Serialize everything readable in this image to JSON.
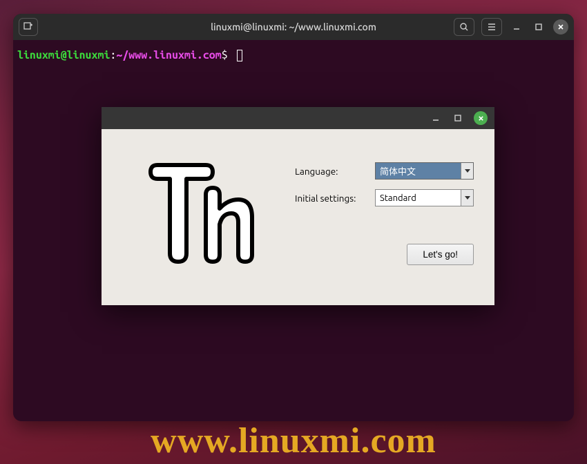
{
  "terminal": {
    "title": "linuxmi@linuxmi: ~/www.linuxmi.com",
    "prompt_user": "linuxmi@linuxmi",
    "prompt_sep": ":",
    "prompt_path": "~/www.linuxmi.com",
    "prompt_dollar": "$"
  },
  "dialog": {
    "language_label": "Language:",
    "language_value": "简体中文",
    "initial_settings_label": "Initial settings:",
    "initial_settings_value": "Standard",
    "go_button": "Let's go!"
  },
  "watermark": "www.linuxmi.com",
  "icons": {
    "new_tab": "new-tab-icon",
    "search": "search-icon",
    "menu": "hamburger-icon",
    "minimize": "minimize-icon",
    "maximize": "maximize-icon",
    "close": "close-icon"
  }
}
